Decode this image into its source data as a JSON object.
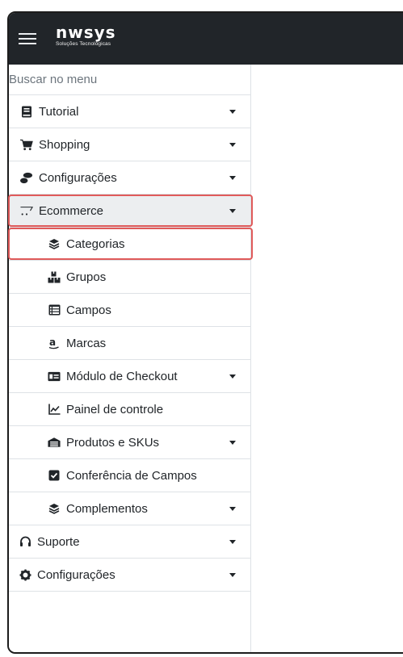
{
  "brand": {
    "name": "nwsys",
    "tagline": "Soluções Tecnológicas"
  },
  "search": {
    "placeholder": "Buscar no menu"
  },
  "menu": {
    "tutorial": "Tutorial",
    "shopping": "Shopping",
    "configuracoes_1": "Configurações",
    "ecommerce": "Ecommerce",
    "ecommerce_items": {
      "categorias": "Categorias",
      "grupos": "Grupos",
      "campos": "Campos",
      "marcas": "Marcas",
      "checkout": "Módulo de Checkout",
      "painel": "Painel de controle",
      "produtos": "Produtos e SKUs",
      "conferencia": "Conferência de Campos",
      "complementos": "Complementos"
    },
    "suporte": "Suporte",
    "configuracoes_2": "Configurações"
  },
  "colors": {
    "topbar": "#212529",
    "highlight": "#e05a5a",
    "active_bg": "#eceef0"
  }
}
